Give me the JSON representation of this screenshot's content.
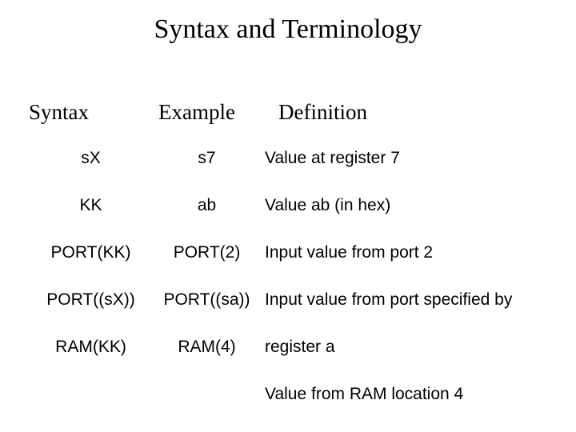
{
  "title": "Syntax and Terminology",
  "headers": {
    "syntax": "Syntax",
    "example": "Example",
    "definition": "Definition"
  },
  "rows": [
    {
      "syntax": "sX",
      "example": "s7",
      "definition": "Value at register 7"
    },
    {
      "syntax": "KK",
      "example": "ab",
      "definition": "Value ab (in hex)"
    },
    {
      "syntax": "PORT(KK)",
      "example": "PORT(2)",
      "definition": "Input value from port 2"
    },
    {
      "syntax": "PORT((sX))",
      "example": "PORT((sa))",
      "definition": "Input value from port specified by"
    },
    {
      "syntax": "RAM(KK)",
      "example": "RAM(4)",
      "definition": "register a"
    },
    {
      "syntax": "",
      "example": "",
      "definition": "Value from RAM location 4"
    }
  ]
}
